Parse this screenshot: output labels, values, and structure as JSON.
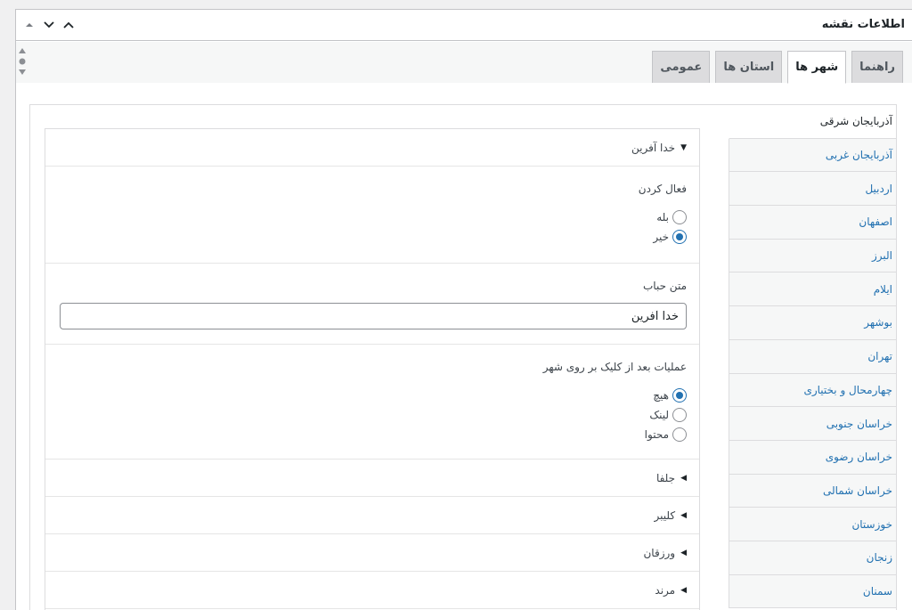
{
  "header": {
    "title": "اطلاعات نقشه"
  },
  "tabs": [
    {
      "label": "عمومی",
      "active": false
    },
    {
      "label": "استان ها",
      "active": false
    },
    {
      "label": "شهر ها",
      "active": true
    },
    {
      "label": "راهنما",
      "active": false
    }
  ],
  "provinces": [
    {
      "label": "آذربایجان شرقی",
      "active": true
    },
    {
      "label": "آذربایجان غربی",
      "active": false
    },
    {
      "label": "اردبیل",
      "active": false
    },
    {
      "label": "اصفهان",
      "active": false
    },
    {
      "label": "البرز",
      "active": false
    },
    {
      "label": "ایلام",
      "active": false
    },
    {
      "label": "بوشهر",
      "active": false
    },
    {
      "label": "تهران",
      "active": false
    },
    {
      "label": "چهارمحال و بختیاری",
      "active": false
    },
    {
      "label": "خراسان جنوبی",
      "active": false
    },
    {
      "label": "خراسان رضوی",
      "active": false
    },
    {
      "label": "خراسان شمالی",
      "active": false
    },
    {
      "label": "خوزستان",
      "active": false
    },
    {
      "label": "زنجان",
      "active": false
    },
    {
      "label": "سمنان",
      "active": false
    }
  ],
  "city_open": {
    "name": "خدا آفرین",
    "activate": {
      "label": "فعال کردن",
      "options": [
        {
          "label": "بله",
          "checked": false
        },
        {
          "label": "خیر",
          "checked": true
        }
      ]
    },
    "bubble": {
      "label": "متن حباب",
      "value": "خدا آفرین"
    },
    "action": {
      "label": "عملیات بعد از کلیک بر روی شهر",
      "options": [
        {
          "label": "هیچ",
          "checked": true
        },
        {
          "label": "لینک",
          "checked": false
        },
        {
          "label": "محتوا",
          "checked": false
        }
      ]
    }
  },
  "cities_collapsed": [
    {
      "name": "جلفا"
    },
    {
      "name": "کلیبر"
    },
    {
      "name": "ورزقان"
    },
    {
      "name": "مرند"
    }
  ]
}
